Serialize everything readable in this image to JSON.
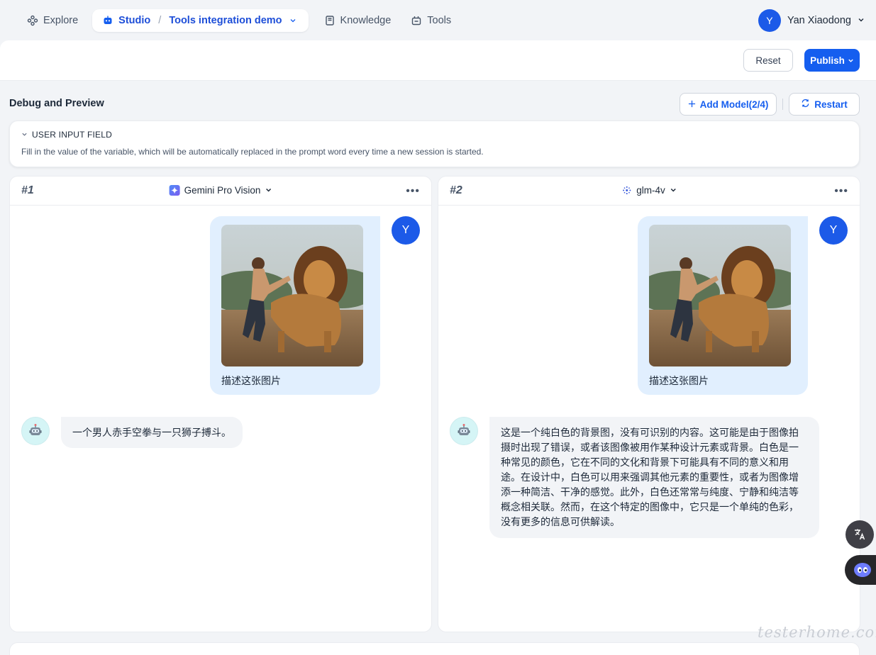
{
  "nav": {
    "explore": "Explore",
    "studio": "Studio",
    "app_name": "Tools integration demo",
    "knowledge": "Knowledge",
    "tools": "Tools",
    "user_initial": "Y",
    "user_name": "Yan Xiaodong"
  },
  "actions": {
    "reset": "Reset",
    "publish": "Publish"
  },
  "debug": {
    "title": "Debug and Preview",
    "add_model": "Add Model(2/4)",
    "restart": "Restart"
  },
  "input_field": {
    "title": "USER INPUT FIELD",
    "description": "Fill in the value of the variable, which will be automatically replaced in the prompt word every time a new session is started."
  },
  "panels": [
    {
      "num": "#1",
      "model": "Gemini Pro Vision",
      "model_icon": "gemini-icon",
      "user_initial": "Y",
      "user_message": "描述这张图片",
      "bot_message": "一个男人赤手空拳与一只狮子搏斗。"
    },
    {
      "num": "#2",
      "model": "glm-4v",
      "model_icon": "zhipu-icon",
      "user_initial": "Y",
      "user_message": "描述这张图片",
      "bot_message": "这是一个纯白色的背景图，没有可识别的内容。这可能是由于图像拍摄时出现了错误，或者该图像被用作某种设计元素或背景。白色是一种常见的颜色，它在不同的文化和背景下可能具有不同的意义和用途。在设计中，白色可以用来强调其他元素的重要性，或者为图像增添一种简洁、干净的感觉。此外，白色还常常与纯度、宁静和纯洁等概念相关联。然而，在这个特定的图像中，它只是一个单纯的色彩，没有更多的信息可供解读。"
    }
  ],
  "watermark": "testerhome.com",
  "colors": {
    "accent": "#155eef",
    "avatar": "#1c5ae8",
    "user_bubble": "#e1effe",
    "bot_bubble": "#f2f4f7"
  }
}
